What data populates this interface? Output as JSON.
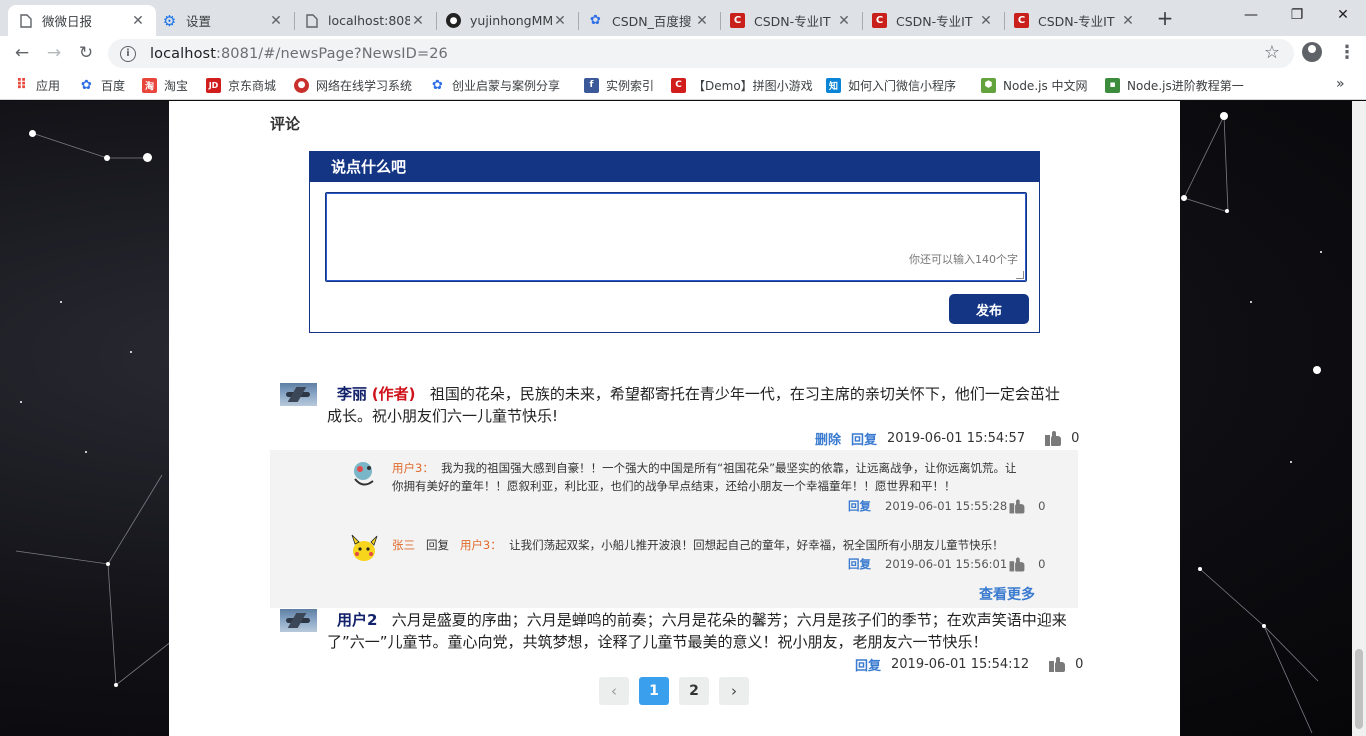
{
  "browser": {
    "tabs": [
      {
        "title": "微微日报",
        "active": true,
        "icon": "doc-icon"
      },
      {
        "title": "设置",
        "active": false,
        "icon": "gear-icon"
      },
      {
        "title": "localhost:808",
        "active": false,
        "icon": "doc-icon"
      },
      {
        "title": "yujinhongMM",
        "active": false,
        "icon": "github-icon"
      },
      {
        "title": "CSDN_百度搜",
        "active": false,
        "icon": "baidu-icon"
      },
      {
        "title": "CSDN-专业IT",
        "active": false,
        "icon": "csdn-icon"
      },
      {
        "title": "CSDN-专业IT",
        "active": false,
        "icon": "csdn-icon"
      },
      {
        "title": "CSDN-专业IT",
        "active": false,
        "icon": "csdn-icon"
      }
    ],
    "new_tab": "+",
    "url_host": "localhost",
    "url_rest": ":8081/#/newsPage?NewsID=26",
    "bookmarks": [
      {
        "label": "应用",
        "color": "#e8453c"
      },
      {
        "label": "百度",
        "color": "#2e6ee6"
      },
      {
        "label": "淘宝",
        "color": "#e8453c"
      },
      {
        "label": "京东商城",
        "color": "#d21d1d"
      },
      {
        "label": "网络在线学习系统",
        "color": "#c9302c"
      },
      {
        "label": "创业启蒙与案例分享",
        "color": "#2e6ee6"
      },
      {
        "label": "实例索引",
        "color": "#3b5998"
      },
      {
        "label": "【Demo】拼图小游戏",
        "color": "#d21d1d"
      },
      {
        "label": "如何入门微信小程序",
        "color": "#0a84d6"
      },
      {
        "label": "Node.js 中文网",
        "color": "#62a33e"
      },
      {
        "label": "Node.js进阶教程第一",
        "color": "#3d8c3d"
      }
    ]
  },
  "comments": {
    "section_title": "评论",
    "box_title": "说点什么吧",
    "textarea_value": "",
    "char_hint": "你还可以输入140个字",
    "publish_label": "发布",
    "list": [
      {
        "user": "李丽",
        "author_tag": "(作者)",
        "text": "祖国的花朵，民族的未来，希望都寄托在青少年一代，在习主席的亲切关怀下，他们一定会茁壮成长。祝小朋友们六一儿童节快乐!",
        "delete_label": "删除",
        "reply_label": "回复",
        "time": "2019-06-01 15:54:57",
        "likes": "0"
      },
      {
        "user": "用户2",
        "text": "六月是盛夏的序曲；六月是蝉鸣的前奏；六月是花朵的馨芳；六月是孩子们的季节；在欢声笑语中迎来了”六一”儿童节。童心向党，共筑梦想，诠释了儿童节最美的意义！祝小朋友，老朋友六一节快乐！",
        "reply_label": "回复",
        "time": "2019-06-01 15:54:12",
        "likes": "0"
      }
    ],
    "replies": [
      {
        "user": "用户3：",
        "text": "我为我的祖国强大感到自豪！！一个强大的中国是所有“祖国花朵”最坚实的依靠，让远离战争，让你远离饥荒。让你拥有美好的童年！！愿叙利亚，利比亚，也们的战争早点结束，还给小朋友一个幸福童年！！愿世界和平！！",
        "reply_label": "回复",
        "time": "2019-06-01 15:55:28",
        "likes": "0"
      },
      {
        "user": "张三",
        "reply_word": "回复",
        "target": "用户3：",
        "text": "让我们荡起双桨，小船儿推开波浪！回想起自己的童年，好幸福，祝全国所有小朋友儿童节快乐！",
        "reply_label": "回复",
        "time": "2019-06-01 15:56:01",
        "likes": "0"
      }
    ],
    "more_label": "查看更多"
  },
  "pagination": {
    "prev": "‹",
    "pages": [
      "1",
      "2"
    ],
    "current": "1",
    "next": "›"
  }
}
